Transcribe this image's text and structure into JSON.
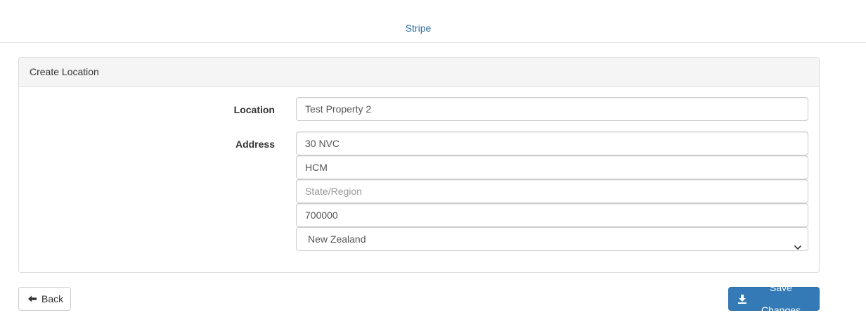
{
  "header": {
    "link_label": "Stripe"
  },
  "panel": {
    "title": "Create Location"
  },
  "form": {
    "location_label": "Location",
    "location_value": "Test Property 2",
    "address_label": "Address",
    "address_line": "30 NVC",
    "city": "HCM",
    "state_placeholder": "State/Region",
    "state_value": "",
    "postcode": "700000",
    "country_selected": "New Zealand"
  },
  "actions": {
    "back_label": "Back",
    "save_label": "Save Changes"
  },
  "icons": {
    "back": "arrow-left-icon",
    "save": "download-icon",
    "select": "chevron-down-icon"
  },
  "colors": {
    "primary": "#337ab7",
    "link": "#2e6da4"
  }
}
